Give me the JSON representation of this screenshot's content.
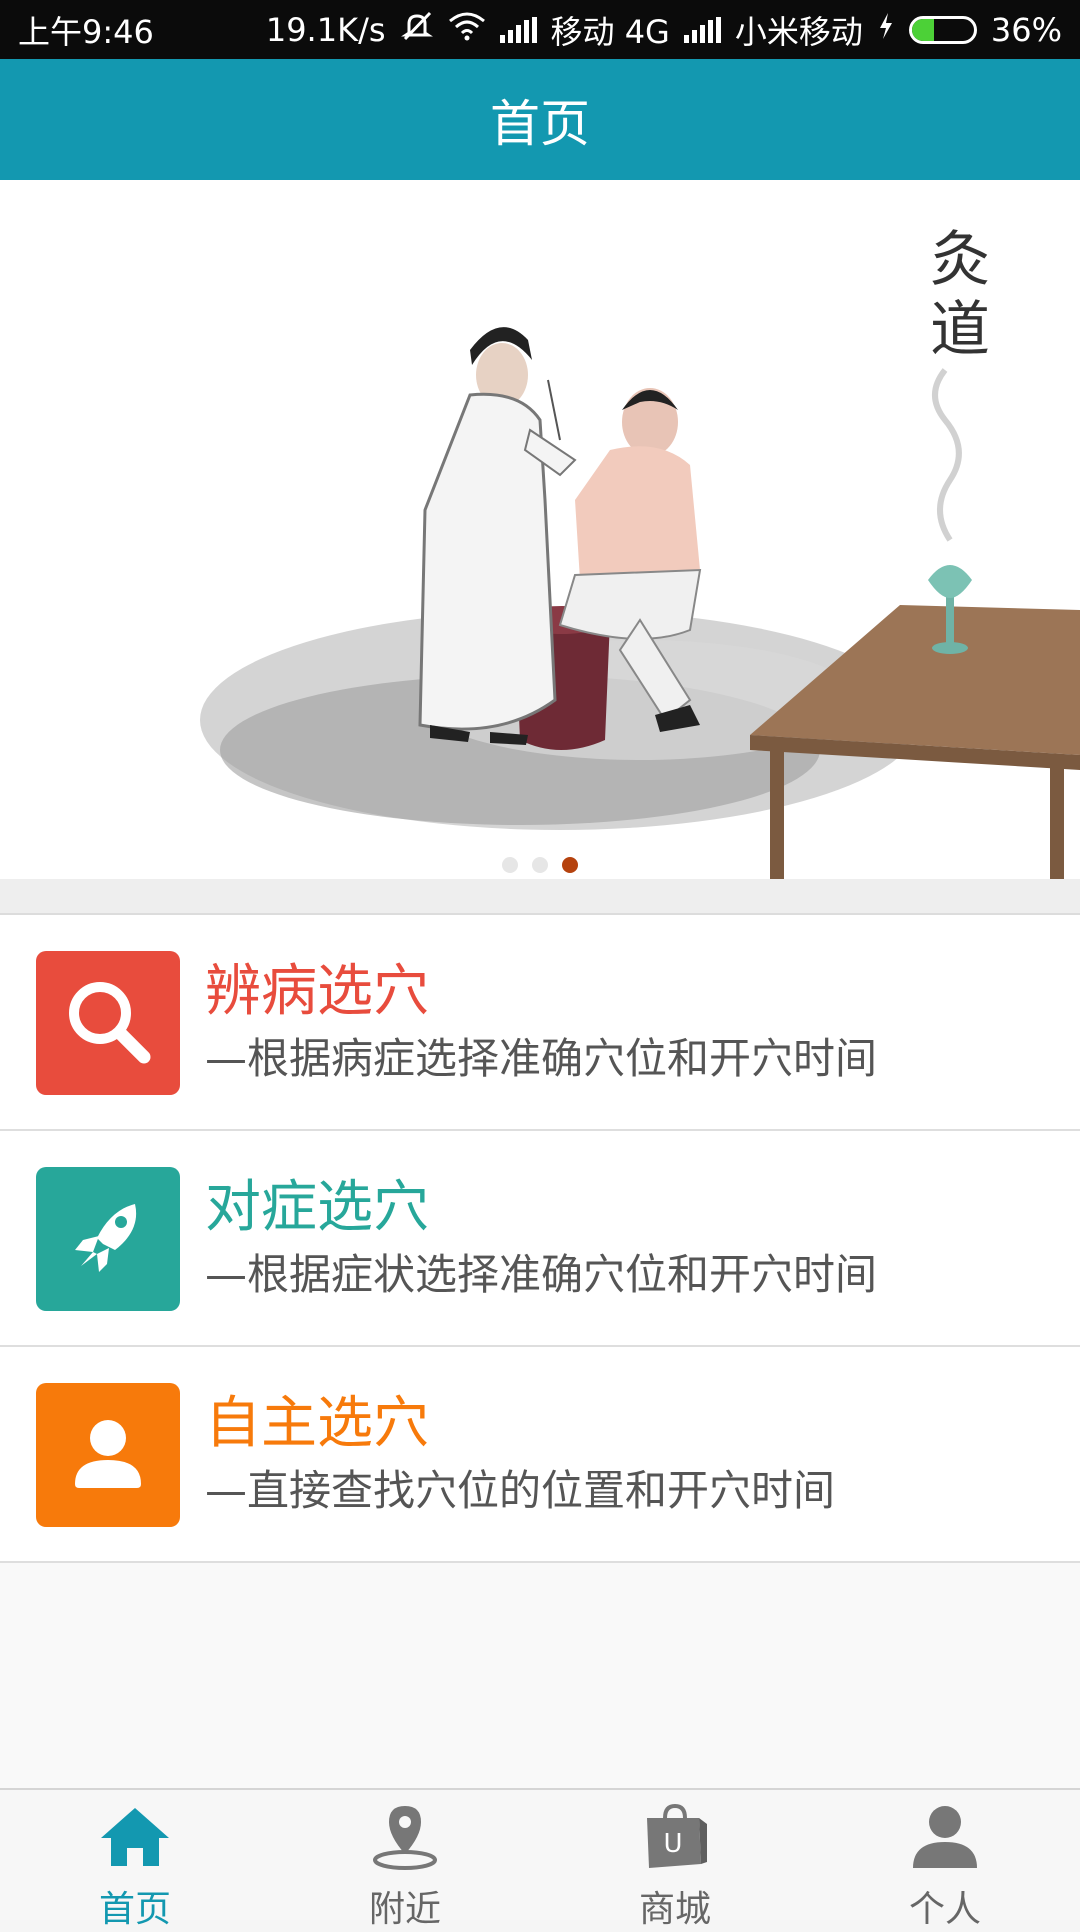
{
  "status_bar": {
    "time": "上午9:46",
    "speed": "19.1K/s",
    "carrier1": "移动 4G",
    "carrier2": "小米移动",
    "battery": "36%",
    "battery_level": 0.36
  },
  "header": {
    "title": "首页"
  },
  "banner": {
    "calligraphy": [
      "灸",
      "道"
    ],
    "slide_count": 3,
    "active_slide": 2
  },
  "menu": [
    {
      "title": "辨病选穴",
      "subtitle": "—根据病症选择准确穴位和开穴时间",
      "color": "#e84c3d",
      "icon": "search-icon"
    },
    {
      "title": "对症选穴",
      "subtitle": "—根据症状选择准确穴位和开穴时间",
      "color": "#27a79a",
      "icon": "rocket-icon"
    },
    {
      "title": "自主选穴",
      "subtitle": "—直接查找穴位的位置和开穴时间",
      "color": "#f77a0b",
      "icon": "person-icon"
    }
  ],
  "nav": {
    "tabs": [
      {
        "label": "首页",
        "icon": "home-icon",
        "active": true
      },
      {
        "label": "附近",
        "icon": "location-pin-icon",
        "active": false
      },
      {
        "label": "商城",
        "icon": "shopping-bag-icon",
        "active": false
      },
      {
        "label": "个人",
        "icon": "user-icon",
        "active": false
      }
    ],
    "active_color": "#1398b0",
    "inactive_color": "#666666"
  }
}
